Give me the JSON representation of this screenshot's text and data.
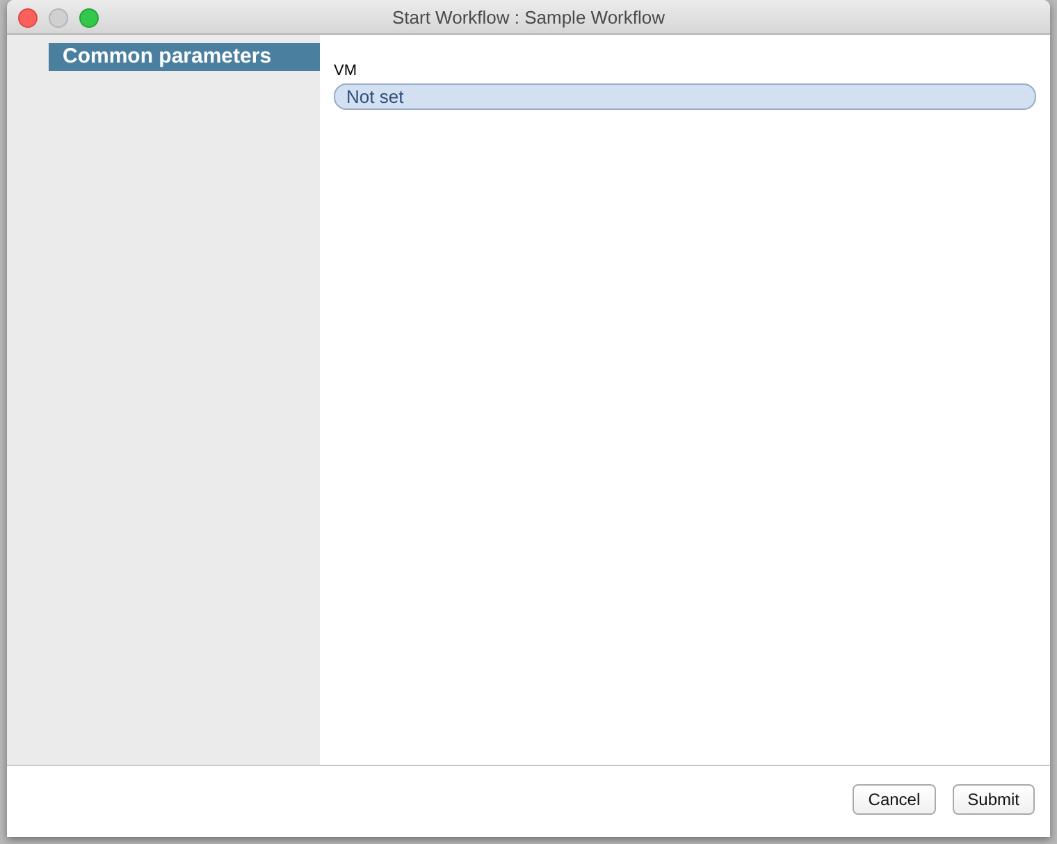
{
  "window": {
    "title": "Start Workflow : Sample Workflow"
  },
  "sidebar": {
    "items": [
      {
        "label": "Common parameters",
        "selected": true
      }
    ]
  },
  "fields": [
    {
      "label": "VM",
      "value": "Not set"
    }
  ],
  "buttons": [
    "Cancel",
    "Submit"
  ]
}
